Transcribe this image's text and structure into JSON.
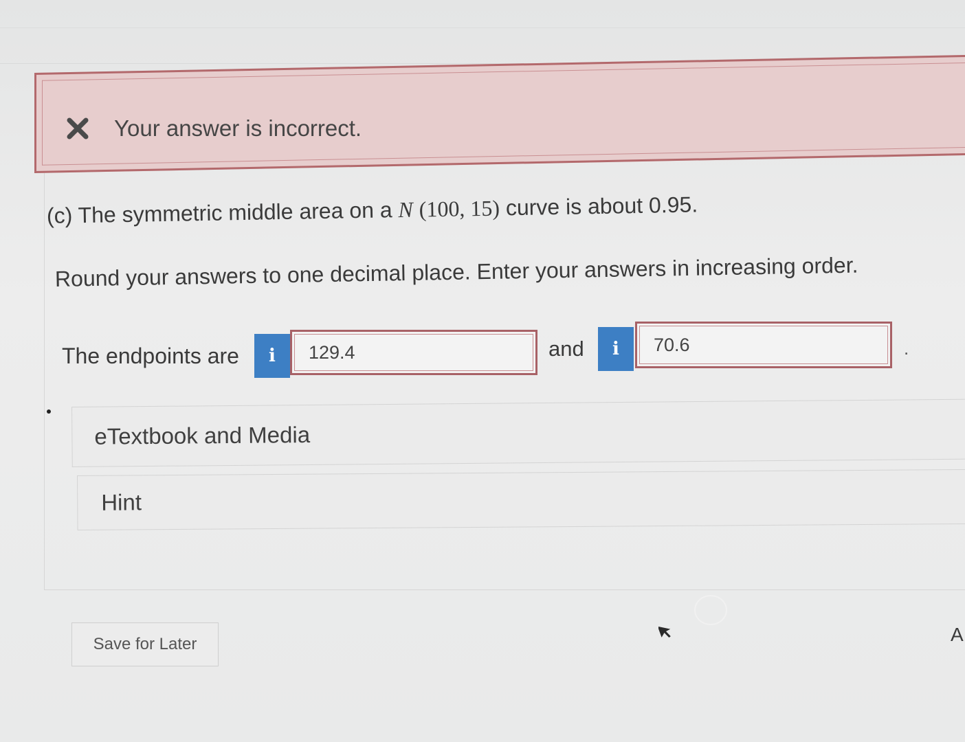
{
  "feedback": {
    "icon": "x-icon",
    "message": "Your answer is incorrect.",
    "color": "#b3696c",
    "background": "#e7cdcd"
  },
  "question": {
    "part_prefix": "(c) The symmetric middle area on a ",
    "distribution_symbol": "N",
    "distribution_params": "(100, 15)",
    "part_suffix": " curve is about 0.95.",
    "instruction": "Round your answers to one decimal place. Enter your answers in increasing order."
  },
  "answers": {
    "label": "The endpoints are",
    "first_value": "129.4",
    "connector": "and",
    "second_value": "70.6",
    "trailing": ".",
    "info_icon_label": "i",
    "info_icon": "info-icon",
    "accent_color": "#3d7fc4"
  },
  "resources": {
    "etextbook_label": "eTextbook and Media",
    "hint_label": "Hint"
  },
  "footer": {
    "save_label": "Save for Later",
    "edge_text": "A"
  }
}
